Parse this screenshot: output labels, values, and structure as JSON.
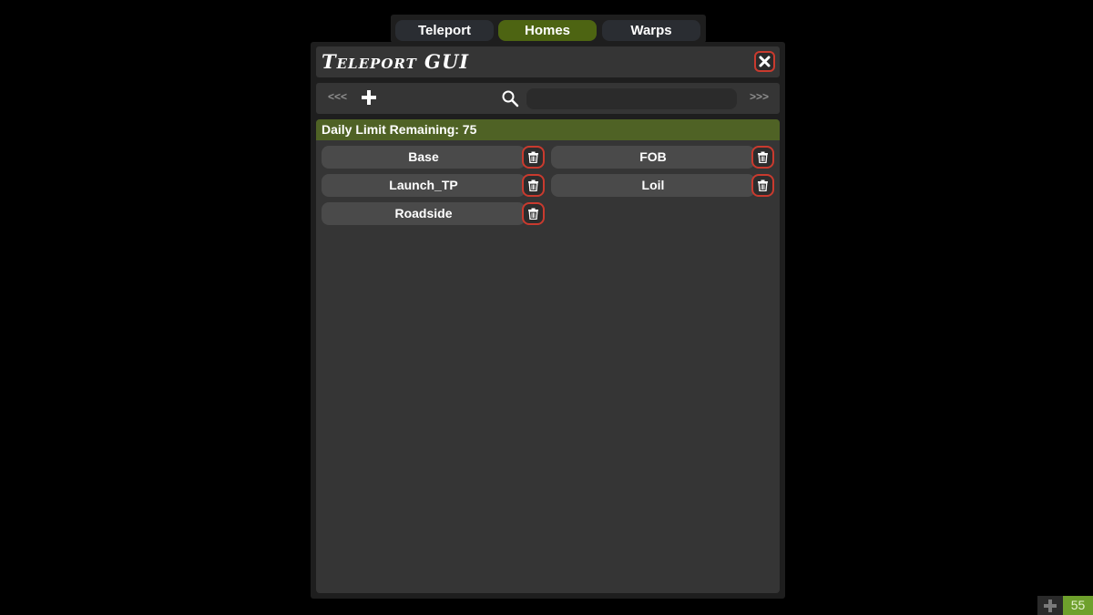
{
  "tabs": [
    {
      "label": "Teleport",
      "active": false
    },
    {
      "label": "Homes",
      "active": true
    },
    {
      "label": "Warps",
      "active": false
    }
  ],
  "panel": {
    "title": "Teleport GUI",
    "close_icon": "close-icon"
  },
  "toolbar": {
    "prev_label": "<<<",
    "next_label": ">>>",
    "add_icon": "plus-icon",
    "search_icon": "search-icon",
    "search_value": ""
  },
  "limit": {
    "text": "Daily Limit Remaining: 75"
  },
  "homes": [
    {
      "name": "Base"
    },
    {
      "name": "FOB"
    },
    {
      "name": "Launch_TP"
    },
    {
      "name": "Loil"
    },
    {
      "name": "Roadside"
    }
  ],
  "corner": {
    "count": "55"
  },
  "colors": {
    "accent_green": "#4d6412",
    "limit_bar": "#4f6225",
    "danger_red": "#c93a2e",
    "counter_green": "#6ea02c"
  }
}
